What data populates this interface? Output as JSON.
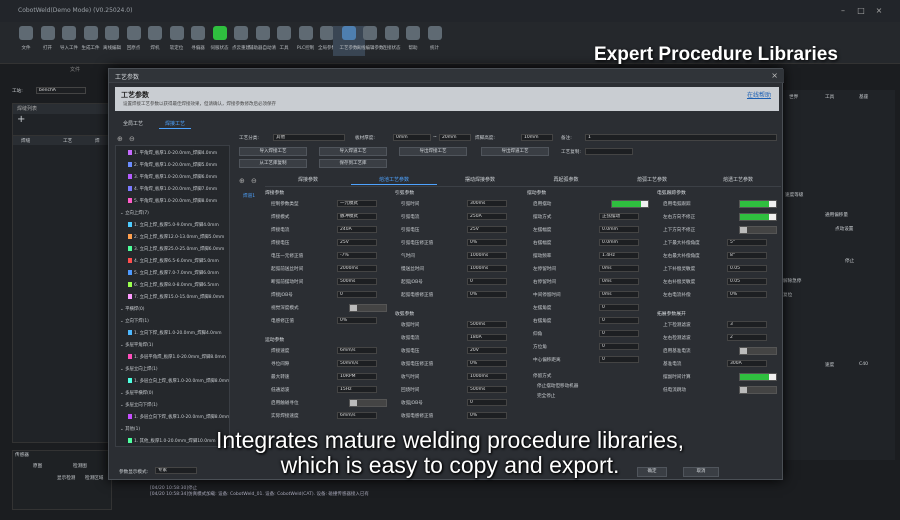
{
  "app": {
    "title": "CobotWeld(Demo Mode) (V0.25024.0)"
  },
  "ribbon": {
    "items": [
      "文件",
      "打开",
      "导入工件",
      "生成工件",
      "离线编辑",
      "回原点",
      "焊机",
      "软定位",
      "寻偏器",
      "伺服状态",
      "点云重建",
      "辅助器自动清",
      "工具",
      "PLC控制",
      "全局参数",
      "工艺参数",
      "离线编辑参数",
      "连接状态",
      "帮助",
      "统计"
    ],
    "group_label": "文件"
  },
  "station": {
    "label": "工站:",
    "value": "benchA"
  },
  "left_panel": {
    "title": "焊缝列表",
    "col1": "焊缝",
    "col2": "工艺",
    "col3": "焊"
  },
  "bottom_log": {
    "title": "传感器",
    "tab1": "原图",
    "tab2": "检测图",
    "chk1": "显示检测",
    "chk2": "检测区域",
    "lines": [
      "[04/20 10:58:30]停止",
      "[04/20 10:58:34]仿真模式加载: 设备: CobotWeld_01. 设备: CobotWeld(CAT). 设备: 碰撞传感器接入已有"
    ]
  },
  "banner": "Expert Procedure Libraries",
  "subtitle": {
    "line1": "Integrates mature welding procedure libraries,",
    "line2": "which is easy to copy and export."
  },
  "dialog": {
    "title": "工艺参数",
    "header": "工艺参数",
    "header_sub": "设置焊接工艺参数以获得最佳焊接效果，但请确认，焊接参数修改后必须保存",
    "help_link": "在线帮助",
    "tabs": [
      "全局工艺",
      "焊接工艺"
    ],
    "toolbar": {
      "cat_label": "工艺分类:",
      "cat_value": "其他",
      "thick_label": "板材厚度:",
      "thick_min": "0mm",
      "thick_max": "20mm",
      "height_label": "焊脚高度:",
      "height_value": "10mm",
      "note_label": "备注:",
      "note_value": "1",
      "btns": [
        "导入焊接工艺",
        "导入焊道工艺",
        "导出焊接工艺",
        "导出焊道工艺",
        "工艺复制:",
        "从工艺库复制",
        "保存到工艺库"
      ]
    },
    "sub_tabs": [
      "焊接参数",
      "熔池工艺参数",
      "摆动焊接参数",
      "再起弧参数",
      "熄弧工艺参数",
      "熔透工艺参数"
    ],
    "weld_passes_link": "焊道1",
    "tree": [
      {
        "label": "1. 平角焊_板厚1.0-20.0mm_焊脚4.0mm",
        "color": "#c66bff"
      },
      {
        "label": "2. 平角焊_板厚1.0-20.0mm_焊脚5.0mm",
        "color": "#6b8cff"
      },
      {
        "label": "3. 平角焊_板厚1.0-20.0mm_焊脚6.0mm",
        "color": "#b45cff"
      },
      {
        "label": "4. 平角焊_板厚1.0-20.0mm_焊脚7.0mm",
        "color": "#7a7aff"
      },
      {
        "label": "5. 平角焊_板厚1.0-20.0mm_焊脚8.0mm",
        "color": "#ff5cc8"
      },
      {
        "label": "立向上焊(7)",
        "color": ""
      },
      {
        "label": "1. 立向上焊_板厚5.0-9.0mm_焊脚4.0mm",
        "color": "#4ecbff"
      },
      {
        "label": "2. 立向上焊_板厚12.0-13.0mm_焊脚5.0mm",
        "color": "#ffa04e"
      },
      {
        "label": "3. 立向上焊_板厚25.0-25.0mm_焊脚6.0mm",
        "color": "#4eff9a"
      },
      {
        "label": "4. 立向上焊_板厚6.5-6.0mm_焊脚5.0mm",
        "color": "#ff4e4e"
      },
      {
        "label": "5. 立向上焊_板厚7.0-7.0mm_焊脚6.0mm",
        "color": "#4e9aff"
      },
      {
        "label": "6. 立向上焊_板厚8.0-8.0mm_焊脚6.5mm",
        "color": "#9aff4e"
      },
      {
        "label": "7. 立向上焊_板厚15.0-15.0mm_焊脚8.0mm",
        "color": "#ff9aff"
      },
      {
        "label": "平横焊(0)",
        "color": ""
      },
      {
        "label": "立向下焊(1)",
        "color": ""
      },
      {
        "label": "1. 立向下焊_板厚1.0-20.0mm_焊脚4.0mm",
        "color": "#4eb8ff"
      },
      {
        "label": "多层平角焊(1)",
        "color": ""
      },
      {
        "label": "1. 多层平角焊_板厚1.0-20.0mm_焊脚8.0mm",
        "color": "#ff4ebb"
      },
      {
        "label": "多层立向上焊(1)",
        "color": ""
      },
      {
        "label": "1. 多层立向上焊_板厚1.0-20.0mm_焊脚8.0mm",
        "color": "#4effe0"
      },
      {
        "label": "多层平横焊(0)",
        "color": ""
      },
      {
        "label": "多层立向下焊(1)",
        "color": ""
      },
      {
        "label": "1. 多层立向下焊_板厚1.0-20.0mm_焊脚8.0mm",
        "color": "#c64eff"
      },
      {
        "label": "其他(1)",
        "color": ""
      },
      {
        "label": "1. 其他_板厚1.0-20.0mm_焊脚10.0mm",
        "color": "#4effa0"
      }
    ],
    "col1": {
      "title": "焊接参数",
      "rows": [
        {
          "label": "控制参数类型",
          "value": "一元模式"
        },
        {
          "label": "焊接模式",
          "value": "脉冲模式"
        },
        {
          "label": "焊接电流",
          "value": "240A"
        },
        {
          "label": "焊接电压",
          "value": "25V"
        },
        {
          "label": "电压一元修正值",
          "value": "-7%"
        },
        {
          "label": "起弧前送丝时间",
          "value": "2000ms"
        },
        {
          "label": "断弧前摆动时间",
          "value": "500ms"
        },
        {
          "label": "焊接JOB号",
          "value": "0"
        },
        {
          "label": "视觉深度模式",
          "value": ""
        },
        {
          "label": "电感修正值",
          "value": "0%"
        }
      ],
      "title2": "运动参数",
      "rows2": [
        {
          "label": "焊接速度",
          "value": "6mm/s"
        },
        {
          "label": "寻位间隙",
          "value": "50mm/s"
        },
        {
          "label": "最大转速",
          "value": "10RPM"
        },
        {
          "label": "低通滤波",
          "value": "15Hz"
        },
        {
          "label": "启用触碰寻位",
          "value": ""
        },
        {
          "label": "实际焊接速度",
          "value": "6mm/s"
        }
      ]
    },
    "col2": {
      "title": "引弧参数",
      "rows": [
        {
          "label": "引弧时间",
          "value": "300ms"
        },
        {
          "label": "引弧电流",
          "value": "250A"
        },
        {
          "label": "引弧电压",
          "value": "25V"
        },
        {
          "label": "引弧电压修正值",
          "value": "0%"
        },
        {
          "label": "气时间",
          "value": "1000ms"
        },
        {
          "label": "慢送丝时间",
          "value": "1000ms"
        },
        {
          "label": "起弧JOB号",
          "value": "0"
        },
        {
          "label": "起弧电感修正值",
          "value": "0%"
        }
      ],
      "title2": "收弧参数",
      "rows2": [
        {
          "label": "收弧时间",
          "value": "500ms"
        },
        {
          "label": "收弧电流",
          "value": "180A"
        },
        {
          "label": "收弧电压",
          "value": "20V"
        },
        {
          "label": "收弧电压修正值",
          "value": "0%"
        },
        {
          "label": "收气时间",
          "value": "1000ms"
        },
        {
          "label": "回烧时间",
          "value": "500ms"
        },
        {
          "label": "收弧JOB号",
          "value": "0"
        },
        {
          "label": "收弧电感修正值",
          "value": "0%"
        }
      ]
    },
    "col3": {
      "title": "摆动参数",
      "rows": [
        {
          "label": "启用摆动",
          "value": ""
        },
        {
          "label": "摆动方式",
          "value": "正弦摆动"
        },
        {
          "label": "左摆幅度",
          "value": "0.0mm"
        },
        {
          "label": "右摆幅度",
          "value": "0.0mm"
        },
        {
          "label": "摆动频率",
          "value": "1.4Hz"
        },
        {
          "label": "左停留时间",
          "value": "0ms"
        },
        {
          "label": "右停留时间",
          "value": "0ms"
        },
        {
          "label": "中间停留时间",
          "value": "0ms"
        },
        {
          "label": "左摆角度",
          "value": "0"
        },
        {
          "label": "右摆角度",
          "value": "0"
        },
        {
          "label": "仰角",
          "value": "0"
        },
        {
          "label": "方位角",
          "value": "0"
        },
        {
          "label": "中心偏移距离",
          "value": "0"
        }
      ],
      "mode_label": "停留方式",
      "radio1": "停止摆动但移动机器",
      "radio2": "完全停止"
    },
    "col4": {
      "title": "电弧跟踪参数",
      "rows": [
        {
          "label": "启用电弧跟踪",
          "value": ""
        },
        {
          "label": "左右方向不修正",
          "value": ""
        },
        {
          "label": "上下方向不修正",
          "value": ""
        },
        {
          "label": "上下最大补偿角度",
          "value": "5°"
        },
        {
          "label": "左右最大补偿角度",
          "value": "8°"
        },
        {
          "label": "上下补偿灵敏度",
          "value": "0.05"
        },
        {
          "label": "左右补偿灵敏度",
          "value": "0.05"
        },
        {
          "label": "左右电流补偿",
          "value": "0%"
        }
      ],
      "expand": "拓展参数展开",
      "rows2": [
        {
          "label": "上下检测滤波",
          "value": "3"
        },
        {
          "label": "左右检测滤波",
          "value": "2"
        },
        {
          "label": "启用基准电流",
          "value": ""
        },
        {
          "label": "基准电流",
          "value": "300A"
        },
        {
          "label": "摆副时间计算",
          "value": ""
        },
        {
          "label": "低电流跳动",
          "value": ""
        }
      ]
    },
    "footer": {
      "show_mode_label": "参数显示模式:",
      "show_mode_value": "专家",
      "ok": "确定",
      "cancel": "取消"
    }
  },
  "right_panel": {
    "labels": [
      "世界",
      "工具",
      "基座",
      "停止",
      "解除急停",
      "复位",
      "速度等级",
      "通用偏移量",
      "点动设置"
    ],
    "cols": [
      "速度",
      "C40"
    ]
  }
}
